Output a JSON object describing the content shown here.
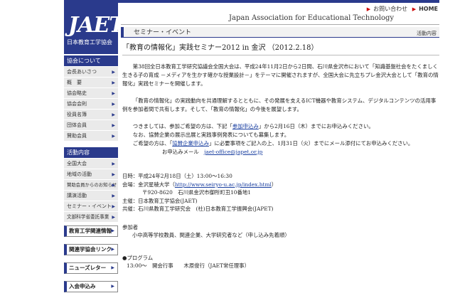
{
  "logo": {
    "text": "JAET",
    "sub": "日本教育工学協会"
  },
  "header": {
    "contact": "お問い合わせ",
    "home": "HOME",
    "association": "Japan Association for Educational Technology"
  },
  "section": {
    "title": "セミナー・イベント",
    "right": "活動内容"
  },
  "sidebar": {
    "group1": {
      "label": "協会について",
      "items": [
        "会長あいさつ",
        "概　要",
        "協会略史",
        "協会会則",
        "役員名簿",
        "団体会員",
        "賛助会員"
      ]
    },
    "group2": {
      "label": "活動内容",
      "items": [
        "全国大会",
        "地域の活動",
        "賛助会員からのお知らせ",
        "講演活動",
        "セミナー・イベント",
        "文部科学省委託事業"
      ]
    },
    "banners": [
      "教育工学関連情報",
      "関連学協会リンク",
      "ニューズレター",
      "入会申込み"
    ]
  },
  "main": {
    "title": "「教育の情報化」実践セミナー2012 in 金沢 （2012.2.18）",
    "p1": "第38回全日本教育工学研究協議会全国大会は、平成24年11月2日から2日間、石川県金沢市において「知識基盤社会をたくましく生きる子の育成 －メディアを生かす確かな授業設計－」をテーマに開催されますが、全国大会に先立ちプレ金沢大会として「教育の情報化」実践セミナーを開催します。",
    "p2": "「教育の情報化」の実践動向を共通理解するとともに、その発展を支えるICT機器や教育システム、デジタルコンテンツの活用事例を参加者間で共有します。そして、「教育の情報化」の今後を展望します。",
    "p3a": "つきましては、参加ご希望の方は、下記「",
    "p3link": "参加申込み",
    "p3b": "」から2月16日（木）までにお申込みください。",
    "p4": "なお、協賛企業の展示出展と実践事例発表についても募集します。",
    "p5a": "ご希望の方は、「",
    "p5link": "協賛企業申込み",
    "p5b": "」に必要事項をご記入の上、1月31日（火）までにメール添付にてお申込みください。",
    "mail_label": "お申込みメール",
    "mail": "jaet-office@japet.or.jp",
    "date": "日時：平成24年2月18日（土）13:00～16:30",
    "venue_a": "会場：金沢星稜大学（",
    "venue_url": "http://www.seiryo-u.ac.jp/index.html",
    "venue_b": "）",
    "address": "〒920-8620　石川県金沢市御所町丑10番地1",
    "host": "主催：日本教育工学協会(JAET)",
    "cohost": "共催：石川県教育工学研究会　(社)日本教育工学振興会(JAPET)",
    "participants_label": "参加者",
    "participants": "小中高等学校教員、関連企業、大学研究者など（申し込み先着順）",
    "program_label": "●プログラム",
    "program_row": "13:00～　開会行事　　木原俊行（JAET常任理事）"
  }
}
